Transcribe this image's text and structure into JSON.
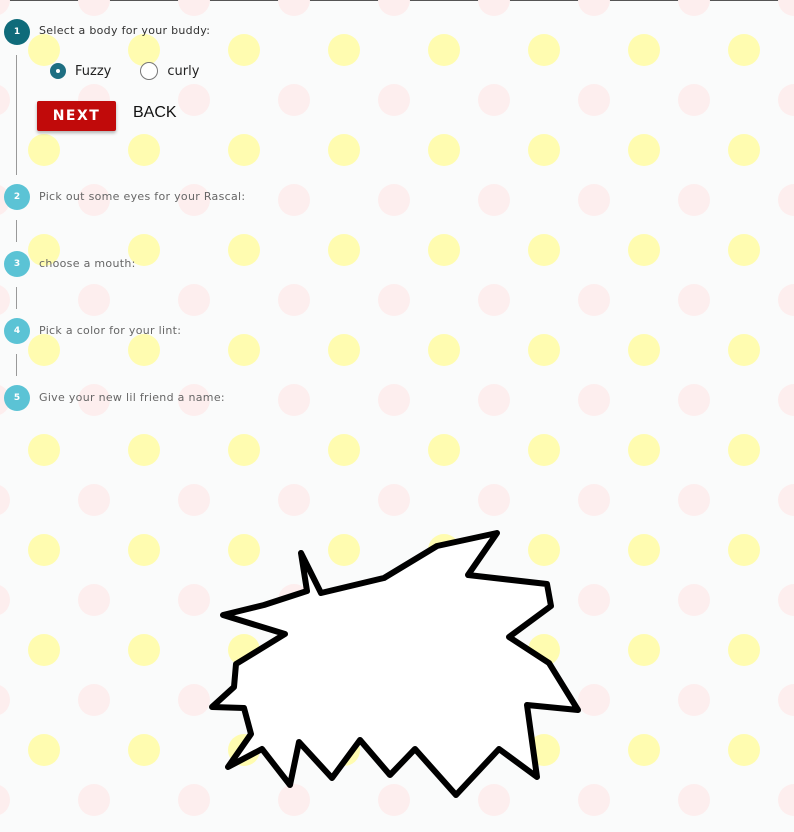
{
  "steps": [
    {
      "number": "1",
      "label": "Select a body for your buddy:"
    },
    {
      "number": "2",
      "label": "Pick out some eyes for your Rascal:"
    },
    {
      "number": "3",
      "label": "choose a mouth:"
    },
    {
      "number": "4",
      "label": "Pick a color for your lint:"
    },
    {
      "number": "5",
      "label": "Give your new lil friend a name:"
    }
  ],
  "body_options": [
    {
      "label": "Fuzzy",
      "selected": true
    },
    {
      "label": "curly",
      "selected": false
    }
  ],
  "buttons": {
    "next": "NEXT",
    "back": "BACK"
  },
  "colors": {
    "active_step": "#0f6b7a",
    "inactive_step": "#5bc3d5",
    "next_button": "#c10a0a",
    "yellow_dot": "#fffcb0",
    "pink_dot": "#fdeeee"
  }
}
